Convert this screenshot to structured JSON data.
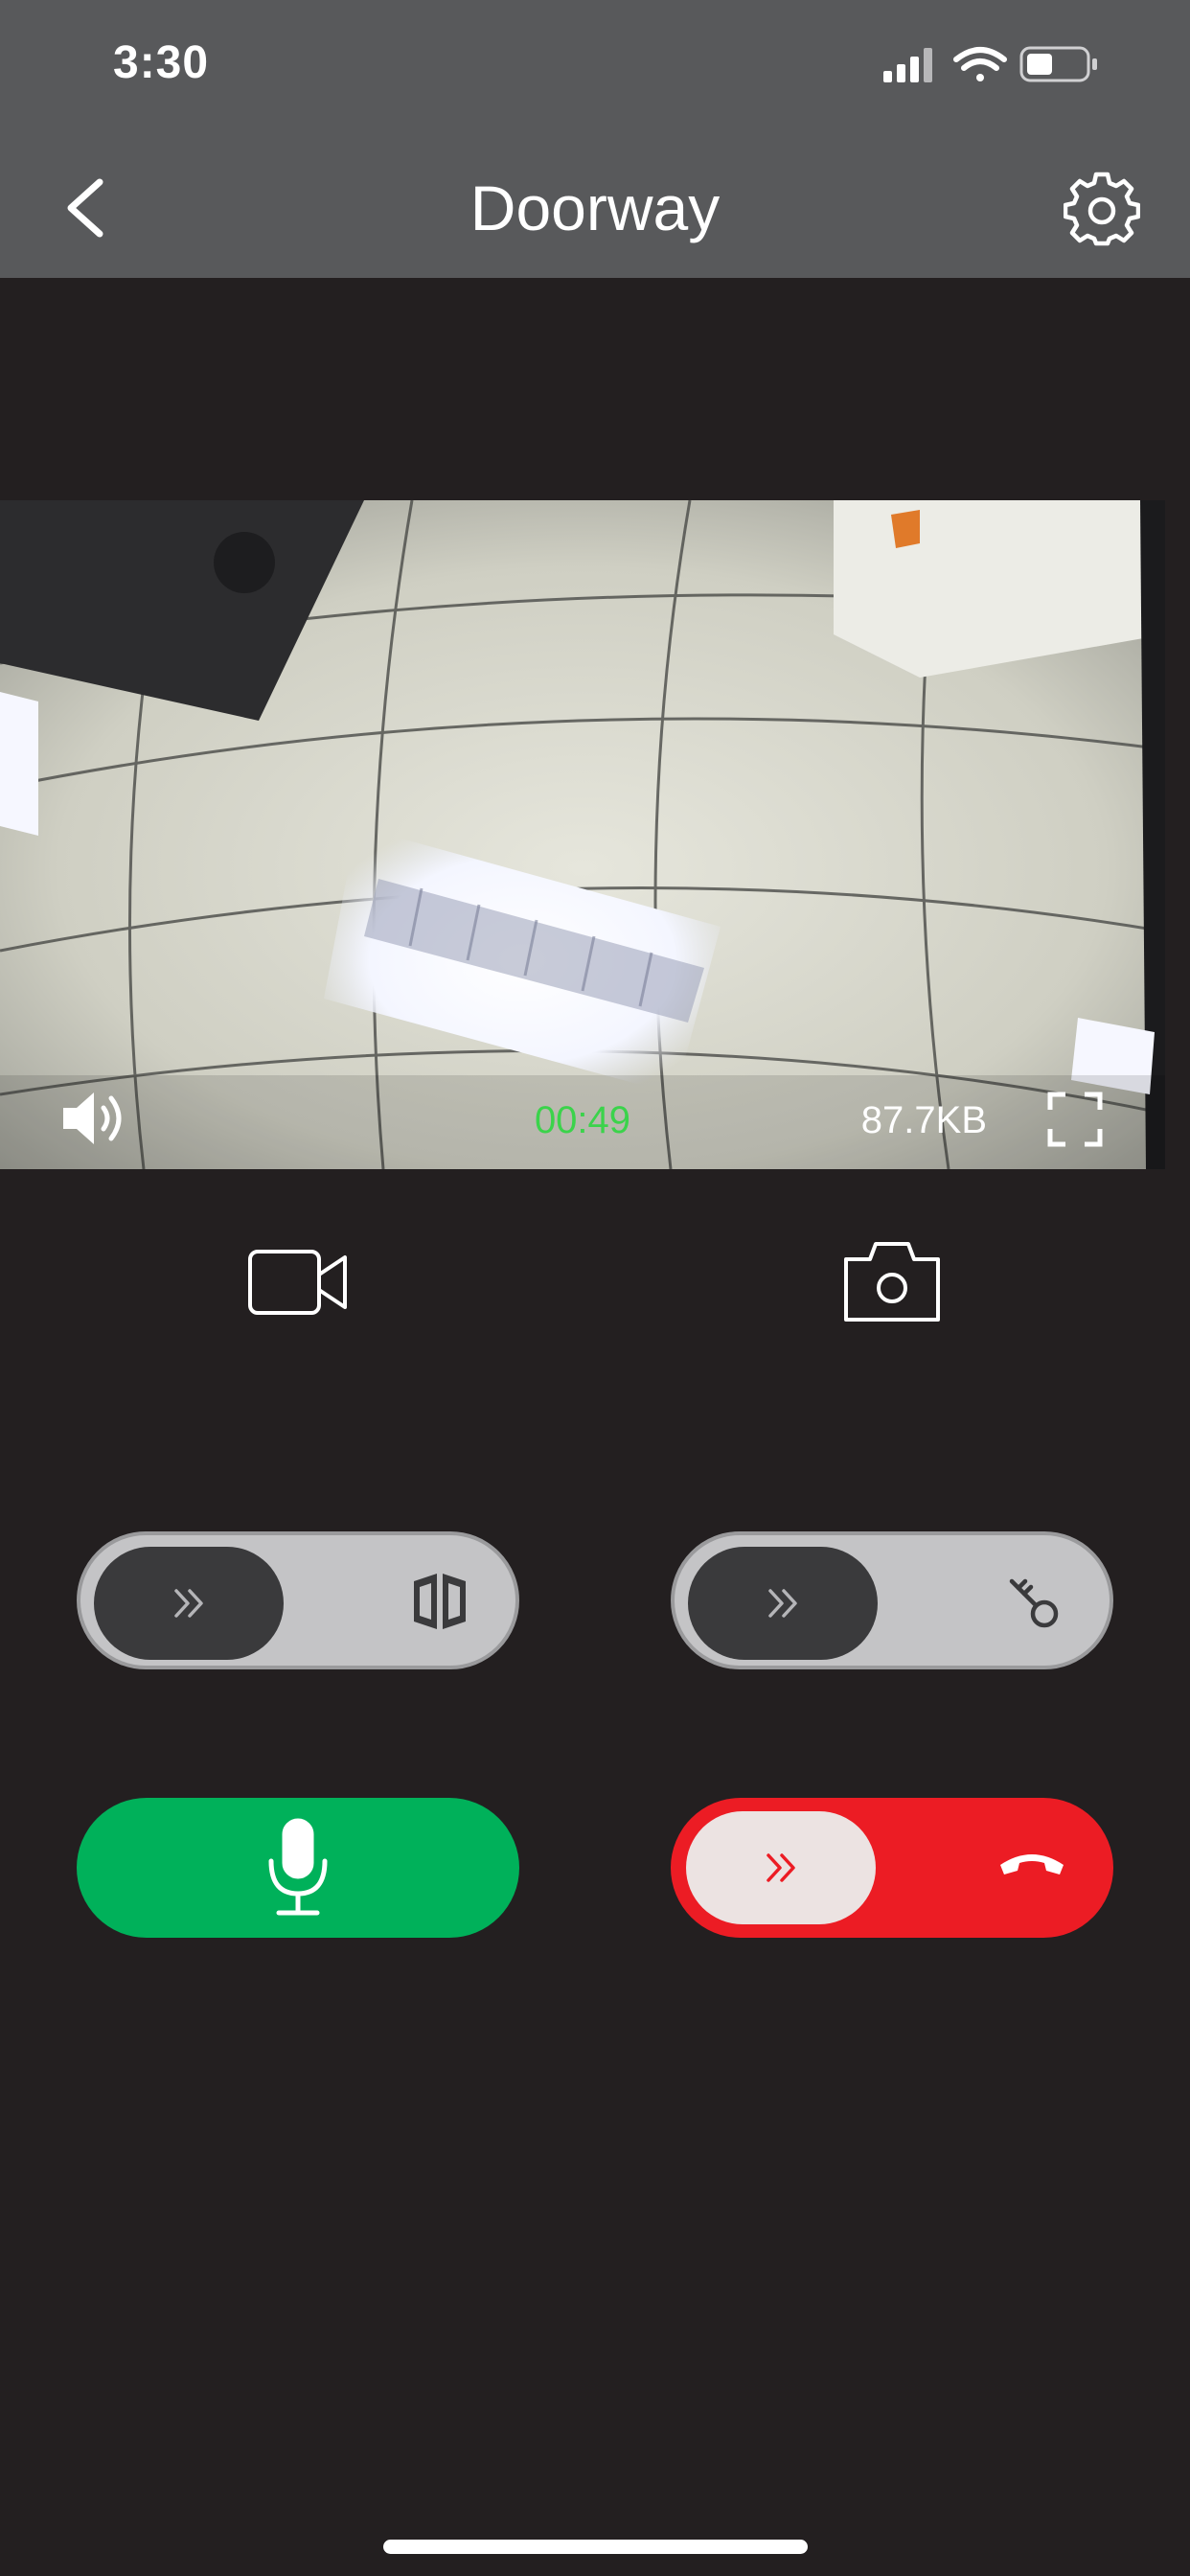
{
  "status_bar": {
    "time": "3:30",
    "icons": [
      "cellular-signal-icon",
      "wifi-icon",
      "battery-icon"
    ]
  },
  "nav": {
    "title": "Doorway",
    "back_icon": "chevron-left-icon",
    "settings_icon": "gear-icon"
  },
  "video": {
    "timer": "00:49",
    "data_size": "87.7KB",
    "speaker_icon": "speaker-icon",
    "fullscreen_icon": "fullscreen-icon"
  },
  "media_controls": {
    "record_icon": "video-camera-icon",
    "snapshot_icon": "camera-icon"
  },
  "sliders": {
    "gate": {
      "knob_icon": "double-chevron-right-icon",
      "end_icon": "gate-icon"
    },
    "lock": {
      "knob_icon": "double-chevron-right-icon",
      "end_icon": "key-icon"
    },
    "hangup": {
      "knob_icon": "double-chevron-right-icon",
      "end_icon": "hang-up-phone-icon"
    }
  },
  "talk_button": {
    "icon": "microphone-icon"
  },
  "colors": {
    "header_bg": "#58595b",
    "screen_bg": "#231f20",
    "timer_green": "#3bd34b",
    "talk_green": "#00b15a",
    "hangup_red": "#ec1c24",
    "slider_gray": "#c4c4c6",
    "knob_dark": "#3a3a3c"
  }
}
